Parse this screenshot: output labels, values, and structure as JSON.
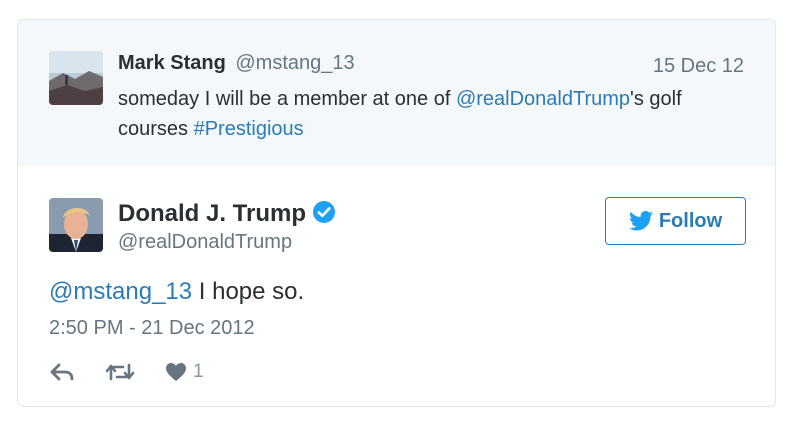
{
  "parent_tweet": {
    "name": "Mark Stang",
    "handle": "@mstang_13",
    "date": "15 Dec 12",
    "text_before": "someday I will be a member at one of ",
    "mention": "@realDonaldTrump",
    "text_after": "'s golf courses ",
    "hashtag": "#Prestigious"
  },
  "tweet": {
    "name": "Donald J. Trump",
    "handle": "@realDonaldTrump",
    "verified": true,
    "mention": "@mstang_13",
    "text": " I hope so.",
    "timestamp": "2:50 PM - 21 Dec 2012",
    "like_count": "1"
  },
  "follow_button": {
    "label": "Follow"
  },
  "icons": {
    "verified": "verified-badge-icon",
    "follow": "twitter-bird-icon",
    "reply": "reply-icon",
    "retweet": "retweet-icon",
    "like": "heart-icon"
  },
  "colors": {
    "link": "#2b7bb9",
    "muted": "#66757f",
    "action": "#8899a6",
    "parent_bg": "#f5f8fa",
    "border": "#e1e8ed"
  }
}
